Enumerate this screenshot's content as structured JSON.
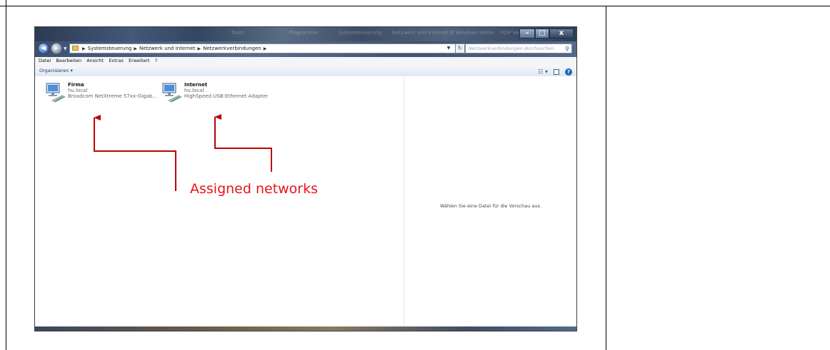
{
  "window": {
    "titlebar_faded_items": [
      "Tools",
      "Programme",
      "Systemsteuerung",
      "Netzwerk und Internet",
      "IE Windows Home",
      "RDP Verbindung"
    ],
    "controls": {
      "minimize": "–",
      "maximize": "□",
      "close": "x"
    }
  },
  "address_bar": {
    "back_glyph": "◀",
    "forward_glyph": "▶",
    "dropdown_glyph": "▼",
    "separator": "▶",
    "breadcrumb": [
      "Systemsteuerung",
      "Netzwerk und Internet",
      "Netzwerkverbindungen"
    ],
    "refresh_glyph": "↻",
    "search_placeholder": "Netzwerkverbindungen durchsuchen",
    "search_icon": "⚲"
  },
  "menu": [
    "Datei",
    "Bearbeiten",
    "Ansicht",
    "Extras",
    "Erweitert",
    "?"
  ],
  "command_bar": {
    "organize": "Organisieren ▾",
    "view_glyph": "☷ ▾",
    "help_glyph": "?"
  },
  "connections": [
    {
      "name": "Firma",
      "domain": "hu.local",
      "adapter": "Broadcom NetXtreme 57xx-Gigab..."
    },
    {
      "name": "Internet",
      "domain": "hu.local",
      "adapter": "HighSpeed USB-Ethernet Adapter"
    }
  ],
  "preview_pane": {
    "text": "Wählen Sie eine Datei für die Vorschau aus."
  },
  "annotation": {
    "label": "Assigned networks",
    "color": "#e8141b"
  }
}
